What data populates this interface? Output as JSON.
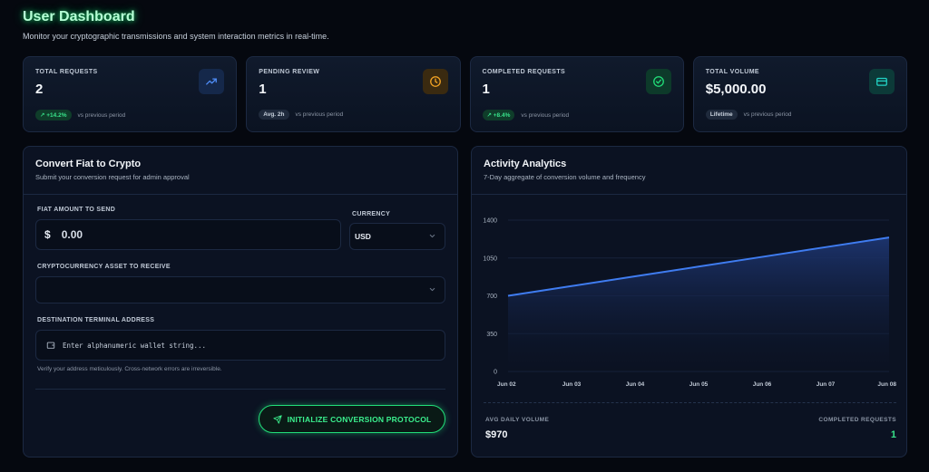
{
  "header": {
    "title": "User Dashboard",
    "subtitle": "Monitor your cryptographic transmissions and system interaction metrics in real-time."
  },
  "stats": [
    {
      "label": "TOTAL REQUESTS",
      "value": "2",
      "badge": "+14.2%",
      "badge_type": "green",
      "foot": "vs previous period",
      "icon": "trending-up-icon",
      "accent": "#4f8df7"
    },
    {
      "label": "PENDING REVIEW",
      "value": "1",
      "badge": "Avg. 2h",
      "badge_type": "gray",
      "foot": "vs previous period",
      "icon": "clock-icon",
      "accent": "#f5a524"
    },
    {
      "label": "COMPLETED REQUESTS",
      "value": "1",
      "badge": "+8.4%",
      "badge_type": "green",
      "foot": "vs previous period",
      "icon": "check-circle-icon",
      "accent": "#22e07a"
    },
    {
      "label": "TOTAL VOLUME",
      "value": "$5,000.00",
      "badge": "Lifetime",
      "badge_type": "gray",
      "foot": "vs previous period",
      "icon": "credit-card-icon",
      "accent": "#22d3c5"
    }
  ],
  "convert": {
    "title": "Convert Fiat to Crypto",
    "subtitle": "Submit your conversion request for admin approval",
    "fiat_label": "FIAT AMOUNT TO SEND",
    "currency_symbol": "$",
    "fiat_value": "0.00",
    "currency_label": "CURRENCY",
    "currency_value": "USD",
    "asset_label": "CRYPTOCURRENCY ASSET TO RECEIVE",
    "asset_value": "",
    "address_label": "DESTINATION TERMINAL ADDRESS",
    "address_placeholder": "Enter alphanumeric wallet string...",
    "hint": "Verify your address meticulously. Cross-network errors are irreversible.",
    "submit_label": "INITIALIZE CONVERSION PROTOCOL"
  },
  "analytics": {
    "title": "Activity Analytics",
    "subtitle": "7-Day aggregate of conversion volume and frequency",
    "avg_label": "AVG DAILY VOLUME",
    "avg_value": "$970",
    "completed_label": "COMPLETED REQUESTS",
    "completed_value": "1"
  },
  "chart_data": {
    "type": "area",
    "x": [
      "Jun 02",
      "Jun 03",
      "Jun 04",
      "Jun 05",
      "Jun 06",
      "Jun 07",
      "Jun 08"
    ],
    "series": [
      {
        "values": [
          700,
          790,
          880,
          970,
          1060,
          1150,
          1240
        ]
      }
    ],
    "ylim": [
      0,
      1400
    ],
    "yticks": [
      0,
      350,
      700,
      1050,
      1400
    ],
    "grid": true,
    "line_color": "#3f7cf0"
  }
}
